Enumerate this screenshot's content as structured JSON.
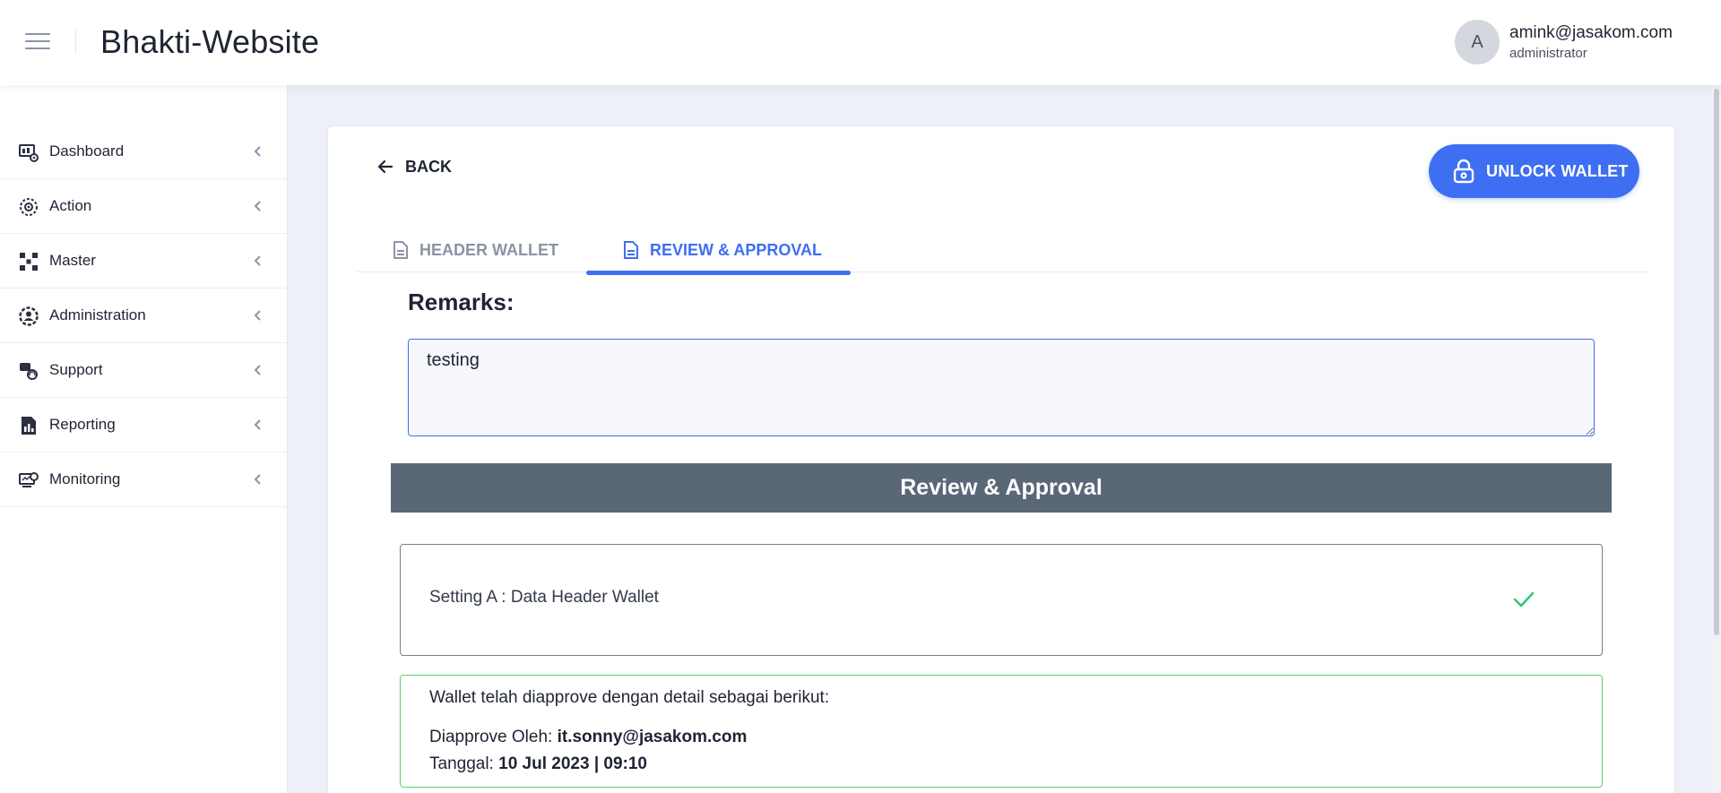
{
  "header": {
    "title": "Bhakti-Website",
    "user": {
      "avatar_initial": "A",
      "email": "amink@jasakom.com",
      "role": "administrator"
    }
  },
  "sidebar": {
    "items": [
      {
        "label": "Dashboard",
        "icon": "dashboard-icon"
      },
      {
        "label": "Action",
        "icon": "action-icon"
      },
      {
        "label": "Master",
        "icon": "master-icon"
      },
      {
        "label": "Administration",
        "icon": "administration-icon"
      },
      {
        "label": "Support",
        "icon": "support-icon"
      },
      {
        "label": "Reporting",
        "icon": "reporting-icon"
      },
      {
        "label": "Monitoring",
        "icon": "monitoring-icon"
      }
    ]
  },
  "toolbar": {
    "back_label": "BACK",
    "unlock_label": "UNLOCK WALLET"
  },
  "tabs": [
    {
      "label": "HEADER WALLET",
      "active": false
    },
    {
      "label": "REVIEW & APPROVAL",
      "active": true
    }
  ],
  "remarks": {
    "label": "Remarks:",
    "value": "testing"
  },
  "review": {
    "banner": "Review & Approval",
    "setting_text": "Setting A : Data Header Wallet",
    "approved_intro": "Wallet telah diapprove dengan detail sebagai berikut:",
    "approved_by_label": "Diapprove Oleh: ",
    "approved_by_value": "it.sonny@jasakom.com",
    "date_label": "Tanggal: ",
    "date_value": "10 Jul 2023 | 09:10"
  },
  "colors": {
    "accent": "#3e6ff2",
    "banner": "#5a6776",
    "success": "#2ecc71",
    "success_border": "#55d466"
  }
}
